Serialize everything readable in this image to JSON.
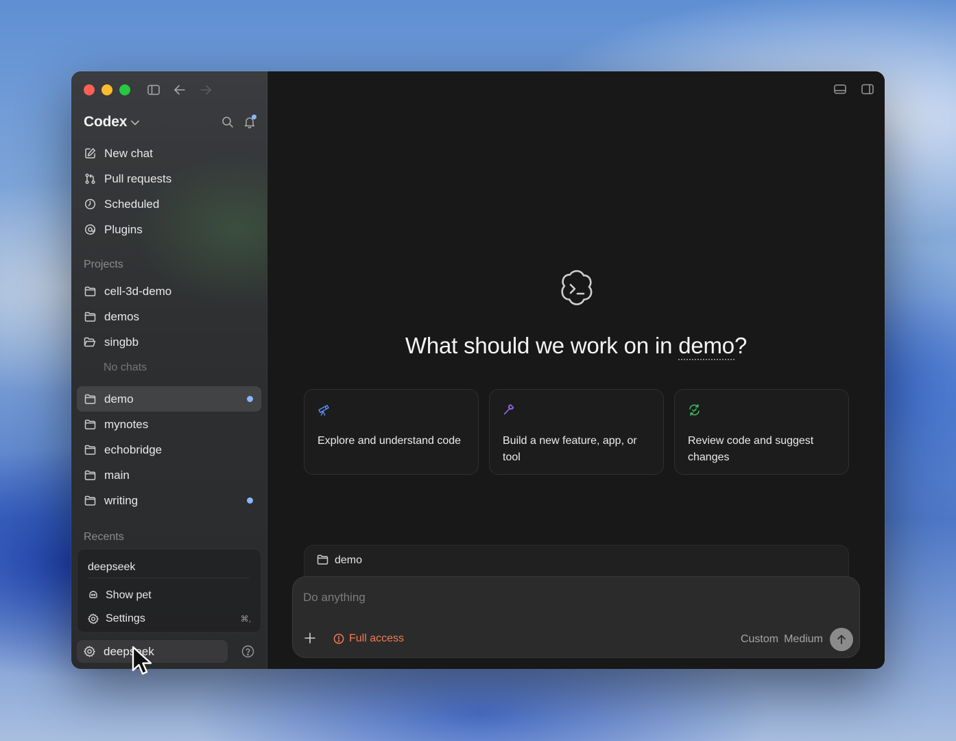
{
  "app": {
    "title": "Codex"
  },
  "sidebar": {
    "nav": [
      {
        "label": "New chat",
        "icon": "compose-icon"
      },
      {
        "label": "Pull requests",
        "icon": "pull-request-icon"
      },
      {
        "label": "Scheduled",
        "icon": "clock-icon"
      },
      {
        "label": "Plugins",
        "icon": "plugin-icon"
      }
    ],
    "projects_label": "Projects",
    "projects": [
      {
        "label": "cell-3d-demo",
        "icon": "folder-icon"
      },
      {
        "label": "demos",
        "icon": "folder-icon"
      },
      {
        "label": "singbb",
        "icon": "folder-open-icon"
      }
    ],
    "no_chats": "No chats",
    "projects2": [
      {
        "label": "demo",
        "icon": "folder-icon",
        "active": true,
        "unread": true
      },
      {
        "label": "mynotes",
        "icon": "folder-icon"
      },
      {
        "label": "echobridge",
        "icon": "folder-icon"
      },
      {
        "label": "main",
        "icon": "folder-icon"
      },
      {
        "label": "writing",
        "icon": "folder-icon",
        "unread": true
      }
    ],
    "recents_label": "Recents",
    "recents_panel": {
      "input_value": "deepseek",
      "show_pet": "Show pet",
      "settings": "Settings",
      "settings_shortcut": "⌘,"
    },
    "account": {
      "label": "deepseek"
    }
  },
  "main": {
    "headline_prefix": "What should we work on in ",
    "headline_project": "demo",
    "headline_suffix": "?",
    "cards": [
      {
        "text": "Explore and understand code",
        "icon": "telescope-icon",
        "color": "#5b8cff"
      },
      {
        "text": "Build a new feature, app, or tool",
        "icon": "hammer-icon",
        "color": "#a070ff"
      },
      {
        "text": "Review code and suggest changes",
        "icon": "refresh-check-icon",
        "color": "#3fbf6a"
      }
    ],
    "repo_chip": "demo",
    "composer": {
      "placeholder": "Do anything",
      "access": "Full access",
      "model_a": "Custom",
      "model_b": "Medium"
    }
  },
  "colors": {
    "accent_blue": "#8ab6ff",
    "access_orange": "#f27a52"
  }
}
